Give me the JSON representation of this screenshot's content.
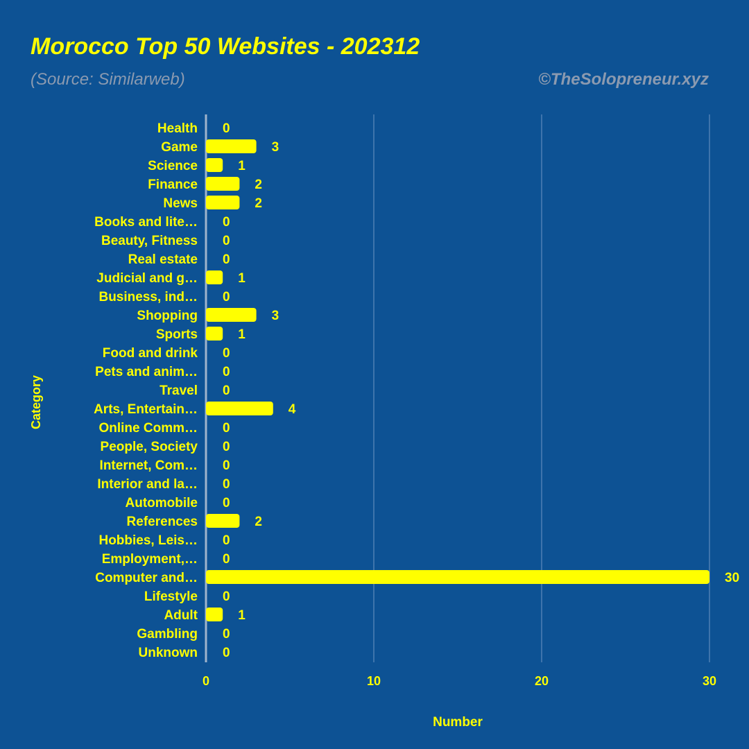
{
  "header": {
    "title": "Morocco Top 50 Websites - 202312",
    "source": "(Source: Similarweb)",
    "copyright": "©TheSolopreneur.xyz"
  },
  "chart_data": {
    "type": "bar",
    "orientation": "horizontal",
    "xlabel": "Number",
    "ylabel": "Category",
    "xlim": [
      0,
      30
    ],
    "xticks": [
      0,
      10,
      20,
      30
    ],
    "grid": true,
    "bar_color": "#ffff00",
    "background_color": "#0d5294",
    "categories": [
      "Health",
      "Game",
      "Science",
      "Finance",
      "News",
      "Books and lite…",
      "Beauty, Fitness",
      "Real estate",
      "Judicial and g…",
      "Business, ind…",
      "Shopping",
      "Sports",
      "Food and drink",
      "Pets and anim…",
      "Travel",
      "Arts, Entertain…",
      "Online Comm…",
      "People, Society",
      "Internet, Com…",
      "Interior and la…",
      "Automobile",
      "References",
      "Hobbies, Leis…",
      "Employment,…",
      "Computer and…",
      "Lifestyle",
      "Adult",
      "Gambling",
      "Unknown"
    ],
    "values": [
      0,
      3,
      1,
      2,
      2,
      0,
      0,
      0,
      1,
      0,
      3,
      1,
      0,
      0,
      0,
      4,
      0,
      0,
      0,
      0,
      0,
      2,
      0,
      0,
      30,
      0,
      1,
      0,
      0
    ]
  }
}
